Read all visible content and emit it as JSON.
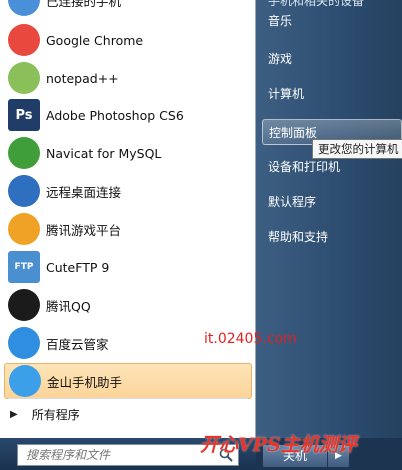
{
  "left_panel": {
    "top_partial_item": {
      "label": "已连接的手机"
    },
    "items": [
      {
        "label": "Google Chrome",
        "icon": "chrome-icon",
        "color": "#e8483d"
      },
      {
        "label": "notepad++",
        "icon": "notepad-plus-plus-icon",
        "color": "#8bbf5a"
      },
      {
        "label": "Adobe Photoshop CS6",
        "icon": "photoshop-icon",
        "color": "#1f3d66",
        "icon_text": "Ps"
      },
      {
        "label": "Navicat for MySQL",
        "icon": "navicat-icon",
        "color": "#3f9d3a"
      },
      {
        "label": "远程桌面连接",
        "icon": "remote-desktop-icon",
        "color": "#2e6fbf"
      },
      {
        "label": "腾讯游戏平台",
        "icon": "tencent-games-icon",
        "color": "#f0a226"
      },
      {
        "label": "CuteFTP 9",
        "icon": "cuteftp-icon",
        "color": "#4a8fd0",
        "icon_text": "FTP"
      },
      {
        "label": "腾讯QQ",
        "icon": "qq-penguin-icon",
        "color": "#1b1b1b"
      },
      {
        "label": "百度云管家",
        "icon": "baidu-cloud-icon",
        "color": "#2f8ee0"
      },
      {
        "label": "金山手机助手",
        "icon": "kingsoft-phone-assistant-icon",
        "color": "#3ba0e8",
        "highlighted": true
      }
    ],
    "all_programs": "所有程序",
    "search_placeholder": "搜索程序和文件"
  },
  "right_panel": {
    "partial_top": "手机和相关的设备",
    "items": [
      "音乐",
      "游戏",
      "计算机",
      "控制面板",
      "设备和打印机",
      "默认程序",
      "帮助和支持"
    ],
    "active_index": 3,
    "tooltip": "更改您的计算机",
    "shutdown_label": "关机"
  },
  "watermarks": {
    "site": "it.02405.com",
    "brand": "开心VPS主机测评"
  }
}
